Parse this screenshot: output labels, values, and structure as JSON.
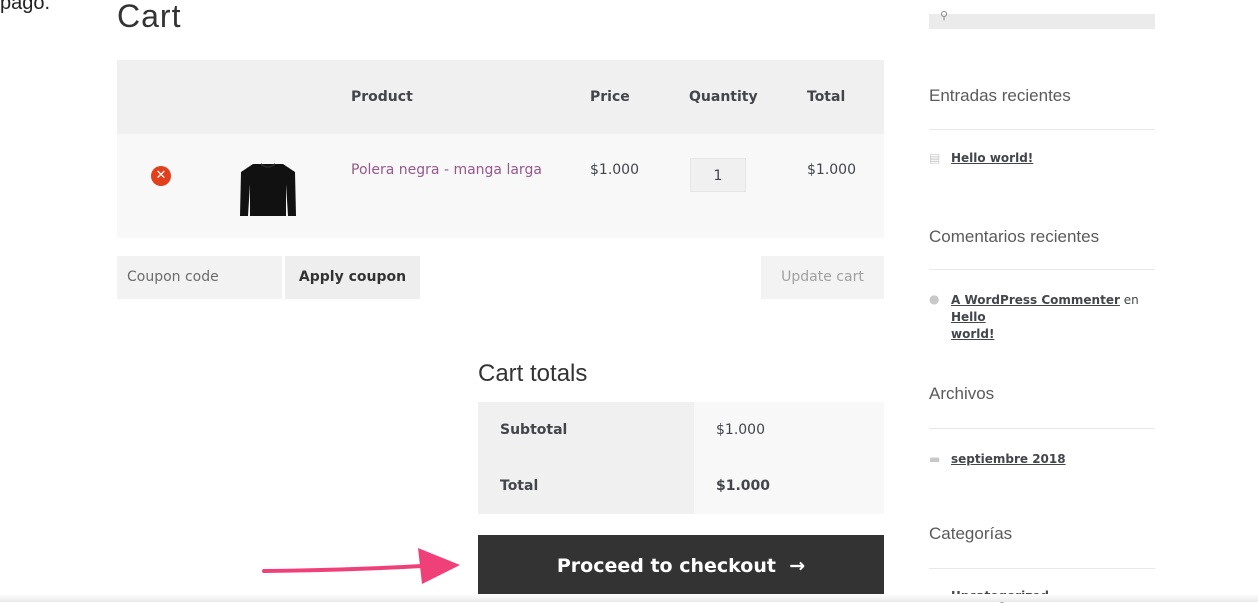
{
  "snippet_text": "pago.",
  "page_title": "Cart",
  "cart_table": {
    "headers": {
      "product": "Product",
      "price": "Price",
      "quantity": "Quantity",
      "total": "Total"
    },
    "items": [
      {
        "name": "Polera negra - manga larga",
        "price": "$1.000",
        "quantity": "1",
        "total": "$1.000"
      }
    ]
  },
  "coupon": {
    "placeholder": "Coupon code",
    "apply_label": "Apply coupon"
  },
  "update_label": "Update cart",
  "cart_totals": {
    "title": "Cart totals",
    "rows": [
      {
        "label": "Subtotal",
        "value": "$1.000"
      },
      {
        "label": "Total",
        "value": "$1.000"
      }
    ]
  },
  "checkout_label": "Proceed to checkout",
  "sidebar": {
    "recent_posts": {
      "title": "Entradas recientes",
      "items": [
        "Hello world!"
      ]
    },
    "recent_comments": {
      "title": "Comentarios recientes",
      "author": "A WordPress Commenter",
      "joiner": "en",
      "post_line1": "Hello",
      "post_line2": "world!"
    },
    "archives": {
      "title": "Archivos",
      "items": [
        "septiembre 2018"
      ]
    },
    "categories": {
      "title": "Categorías",
      "items": [
        "Uncategorized"
      ]
    }
  },
  "colors": {
    "accent_link": "#96588a",
    "remove": "#e2401c",
    "arrow": "#f0407a",
    "checkout_bg": "#333333"
  },
  "icons": [
    "remove-icon",
    "product-thumbnail",
    "document-icon",
    "comment-icon",
    "folder-icon",
    "arrow-right-icon",
    "search-icon"
  ]
}
